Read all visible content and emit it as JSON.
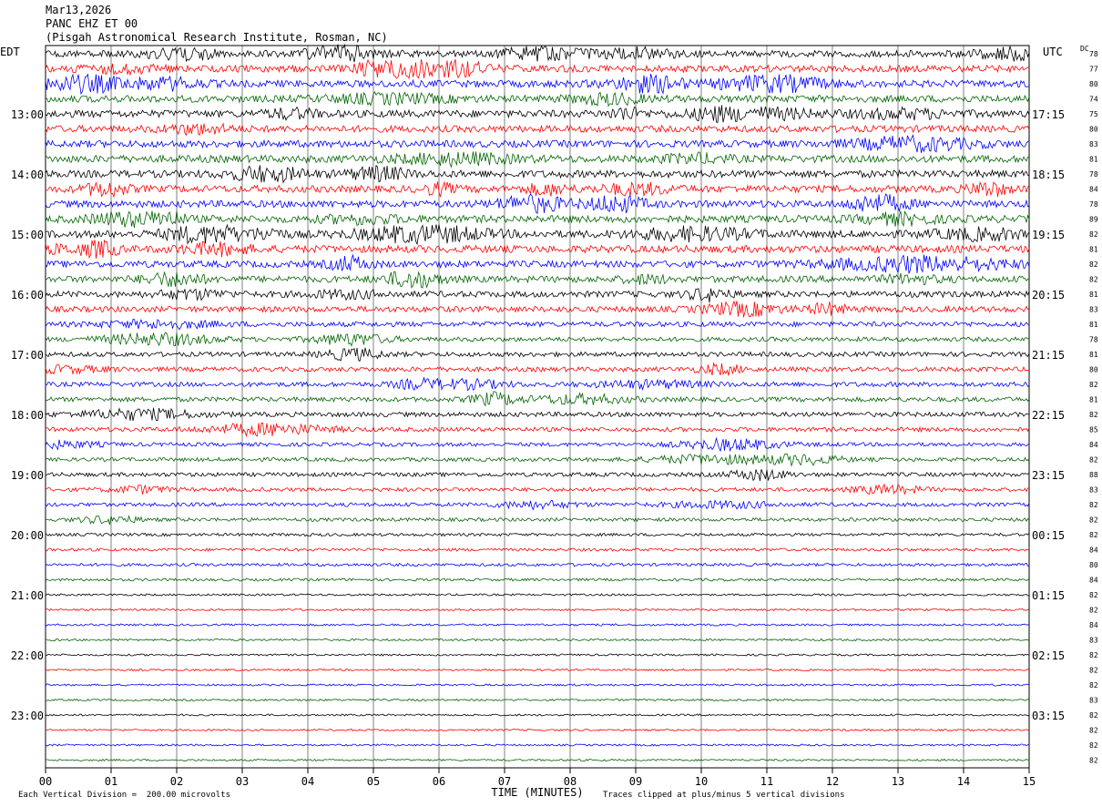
{
  "header": {
    "date": "Mar13,2026",
    "station": "PANC EHZ ET 00",
    "location": "(Pisgah Astronomical Research Institute, Rosman, NC)"
  },
  "chart_data": {
    "type": "line",
    "title": "",
    "xlabel": "TIME (MINUTES)",
    "ylabel": "",
    "xlim": [
      0,
      15
    ],
    "x_ticks": [
      "00",
      "01",
      "02",
      "03",
      "04",
      "05",
      "06",
      "07",
      "08",
      "09",
      "10",
      "11",
      "12",
      "13",
      "14",
      "15"
    ],
    "left_axis_title": "EDT",
    "right_axis_title": "UTC",
    "dc_title": "DC",
    "left_hour_labels": [
      "13:00",
      "14:00",
      "15:00",
      "16:00",
      "17:00",
      "18:00",
      "19:00",
      "20:00",
      "21:00",
      "22:00",
      "23:00"
    ],
    "right_hour_labels": [
      "17:15",
      "18:15",
      "19:15",
      "20:15",
      "21:15",
      "22:15",
      "23:15",
      "00:15",
      "01:15",
      "02:15",
      "03:15"
    ],
    "trace_colors": [
      "#000000",
      "#ff0000",
      "#0000ff",
      "#006400"
    ],
    "trace_count": 48,
    "first_labeled_trace": 4,
    "dc_offsets": [
      "78",
      "77",
      "80",
      "74",
      "75",
      "80",
      "83",
      "81",
      "78",
      "84",
      "78",
      "89",
      "82",
      "81",
      "82",
      "82",
      "81",
      "83",
      "81",
      "78",
      "81",
      "80",
      "82",
      "81",
      "82",
      "85",
      "84",
      "82",
      "88",
      "83",
      "82",
      "82",
      "82",
      "84",
      "80",
      "84",
      "82",
      "82",
      "84",
      "83",
      "82",
      "82",
      "82",
      "83",
      "82",
      "82",
      "82",
      "82"
    ],
    "activity_level": [
      0.9,
      0.9,
      0.95,
      0.95,
      1.0,
      0.9,
      0.95,
      1.0,
      1.0,
      0.95,
      0.95,
      1.0,
      1.0,
      1.0,
      0.9,
      0.85,
      0.8,
      0.75,
      0.6,
      0.5,
      0.55,
      0.55,
      0.55,
      0.55,
      0.55,
      0.5,
      0.4,
      0.4,
      0.45,
      0.4,
      0.4,
      0.35,
      0.25,
      0.25,
      0.25,
      0.2,
      0.1,
      0.1,
      0.1,
      0.12,
      0.08,
      0.08,
      0.08,
      0.08,
      0.07,
      0.07,
      0.07,
      0.07
    ],
    "footer_left": "Each Vertical Division =  200.00 microvolts",
    "footer_right": "Traces clipped at plus/minus 5 vertical divisions"
  }
}
